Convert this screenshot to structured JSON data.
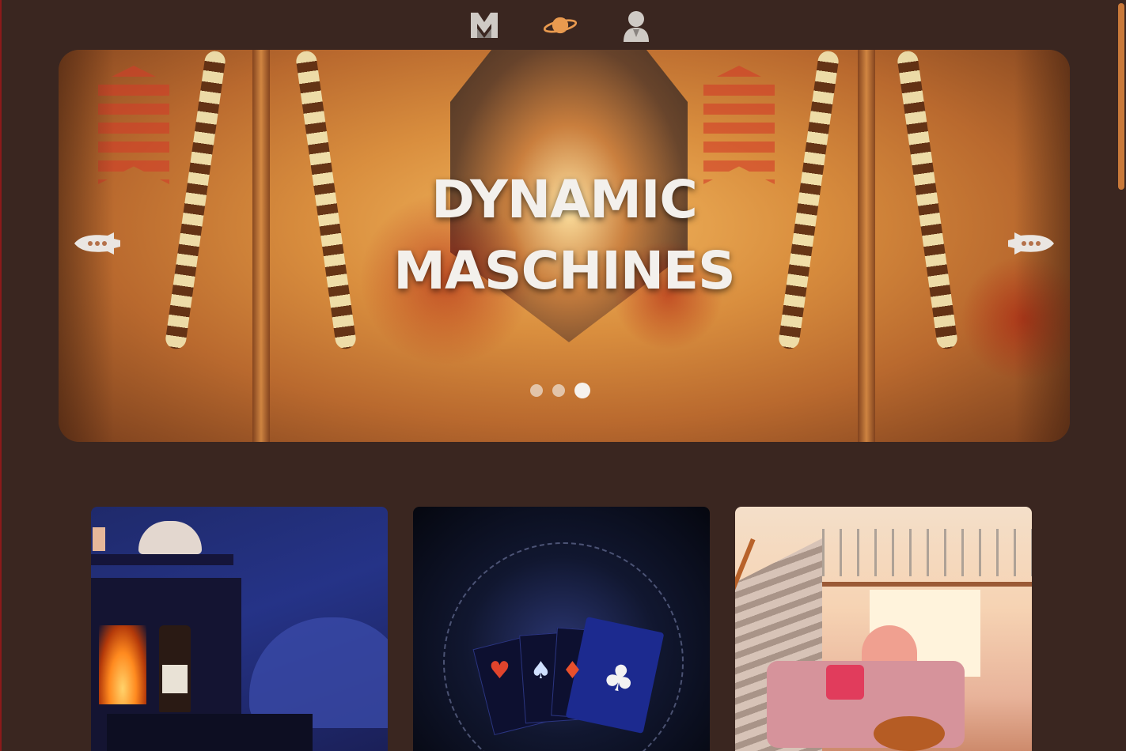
{
  "nav": {
    "items": [
      {
        "icon": "m-logo-icon"
      },
      {
        "icon": "planet-icon"
      },
      {
        "icon": "user-icon"
      }
    ],
    "colors": {
      "logo": "#cfcac5",
      "planet": "#e99a4f",
      "user": "#cfcac5"
    }
  },
  "hero": {
    "title_line1": "DYNAMIC",
    "title_line2": "MASCHINES",
    "prev_icon": "rocket-left-icon",
    "next_icon": "rocket-right-icon",
    "slides_count": 3,
    "active_slide": 3
  },
  "cards": [
    {
      "image": "fireplace-living-room"
    },
    {
      "image": "playing-cards-aces"
    },
    {
      "image": "loft-interior"
    }
  ],
  "colors": {
    "background": "#3a2620",
    "accent": "#e99a4f",
    "scrollbar": "#c9793a"
  }
}
